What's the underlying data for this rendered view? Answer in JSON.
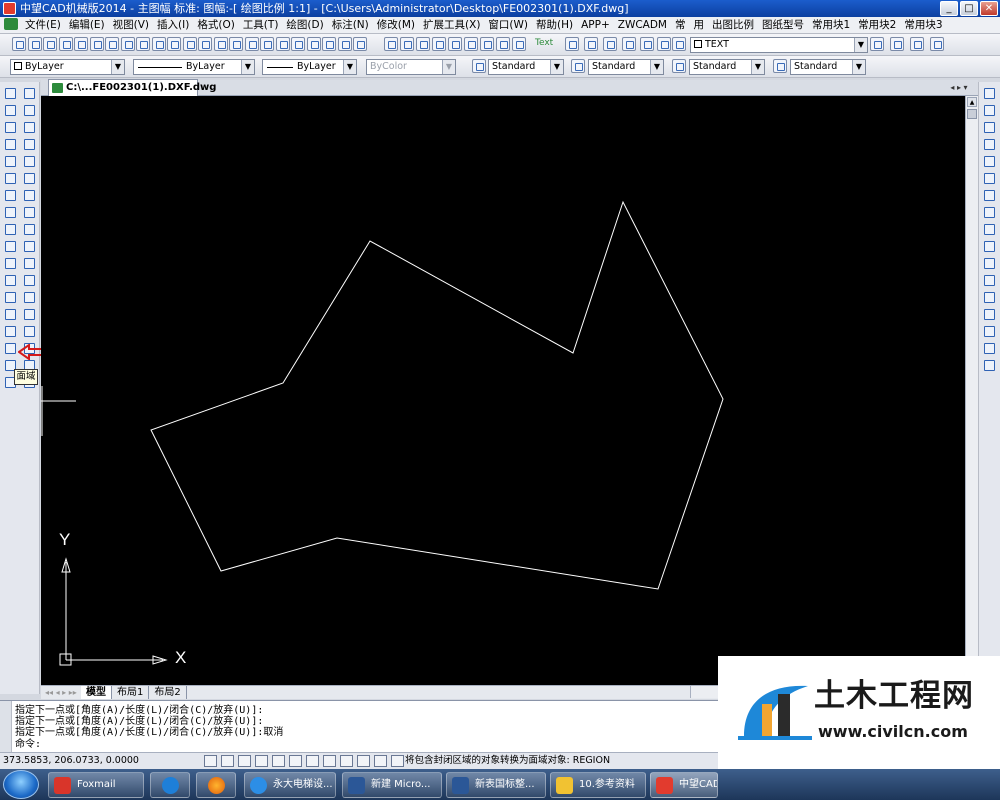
{
  "window": {
    "title": "中望CAD机械版2014 - 主图幅  标准: 图幅:-[ 绘图比例 1:1] - [C:\\Users\\Administrator\\Desktop\\FE002301(1).DXF.dwg]",
    "min": "_",
    "restore": "□",
    "close": "✕"
  },
  "menu": [
    "文件(E)",
    "编辑(E)",
    "视图(V)",
    "插入(I)",
    "格式(O)",
    "工具(T)",
    "绘图(D)",
    "标注(N)",
    "修改(M)",
    "扩展工具(X)",
    "窗口(W)",
    "帮助(H)",
    "APP+",
    "ZWCADM",
    "常",
    "用",
    "出图比例",
    "图纸型号",
    "常用块1",
    "常用块2",
    "常用块3"
  ],
  "toolbar1": {
    "text_label": "Text",
    "text_style_combo": "TEXT"
  },
  "toolbar2": {
    "layer_combo": "ByLayer",
    "linetype_combo": "ByLayer",
    "lineweight_combo": "ByLayer",
    "color_combo": "ByColor",
    "text_style": "Standard",
    "dim_style": "Standard",
    "table_style": "Standard",
    "multileader_style": "Standard"
  },
  "document": {
    "tab_label": "C:\\...FE002301(1).DXF.dwg",
    "tab_nav": "◂ ▸ ▾"
  },
  "canvas": {
    "background": "#000000",
    "line_color": "#ffffff",
    "ucs_x": "X",
    "ucs_y": "Y"
  },
  "tooltip": "面域",
  "layout_tabs": [
    "模型",
    "布局1",
    "布局2"
  ],
  "layout_nav": "◂◂ ◂ ▸ ▸▸",
  "command_lines": [
    "指定下一点或[角度(A)/长度(L)/闭合(C)/放弃(U)]:",
    "指定下一点或[角度(A)/长度(L)/闭合(C)/放弃(U)]:",
    "指定下一点或[角度(A)/长度(L)/闭合(C)/放弃(U)]:取消",
    "命令:"
  ],
  "status": {
    "coordinates": "373.5853, 206.0733, 0.0000",
    "message": "将包含封闭区域的对象转换为面域对象:  REGION"
  },
  "taskbar": {
    "items": [
      "Foxmail",
      "",
      "",
      "永大电梯设...",
      "新建 Micro...",
      "新表国标整...",
      "10.参考资料",
      "中望CAD"
    ]
  },
  "watermark": {
    "name": "土木工程网",
    "url": "www.civilcn.com"
  }
}
